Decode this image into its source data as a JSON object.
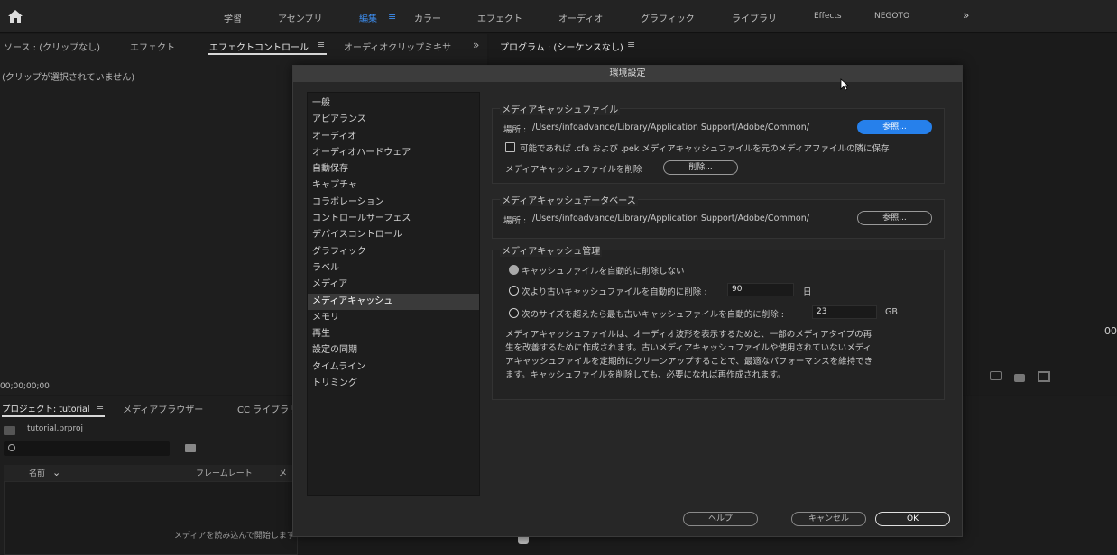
{
  "topbar": {
    "workspaces": [
      "学習",
      "アセンブリ",
      "編集",
      "カラー",
      "エフェクト",
      "オーディオ",
      "グラフィック",
      "ライブラリ",
      "Effects",
      "NEGOTO"
    ],
    "menu_glyph": "≡",
    "more_glyph": "»"
  },
  "left_panel": {
    "tabs": [
      "ソース : (クリップなし)",
      "エフェクト",
      "エフェクトコントロール",
      "オーディオクリップミキサ"
    ],
    "tab_menu_glyph": "≡",
    "more_glyph": "»",
    "empty_message": "(クリップが選択されていません)",
    "timecode": "00;00;00;00"
  },
  "program_panel": {
    "title": "プログラム : (シーケンスなし)",
    "menu_glyph": "≡",
    "timecode_fragment": "00"
  },
  "project_panel": {
    "tabs": [
      "プロジェクト: tutorial",
      "メディアブラウザー",
      "CC ライブラリ"
    ],
    "menu_glyph": "≡",
    "project_file": "tutorial.prproj",
    "columns": [
      "名前",
      "フレームレート",
      "メ"
    ],
    "empty_message": "メディアを読み込んで開始します"
  },
  "dialog": {
    "title": "環境設定",
    "categories": [
      "一般",
      "アピアランス",
      "オーディオ",
      "オーディオハードウェア",
      "自動保存",
      "キャプチャ",
      "コラボレーション",
      "コントロールサーフェス",
      "デバイスコントロール",
      "グラフィック",
      "ラベル",
      "メディア",
      "メディアキャッシュ",
      "メモリ",
      "再生",
      "設定の同期",
      "タイムライン",
      "トリミング"
    ],
    "selected_category": "メディアキャッシュ",
    "cache_files": {
      "title": "メディアキャッシュファイル",
      "location_label": "場所 :",
      "location_path": "/Users/infoadvance/Library/Application Support/Adobe/Common/",
      "browse_label": "参照...",
      "checkbox_label": "可能であれば .cfa および .pek メディアキャッシュファイルを元のメディアファイルの隣に保存",
      "delete_label": "メディアキャッシュファイルを削除",
      "delete_button": "削除..."
    },
    "cache_db": {
      "title": "メディアキャッシュデータベース",
      "location_label": "場所 :",
      "location_path": "/Users/infoadvance/Library/Application Support/Adobe/Common/",
      "browse_label": "参照..."
    },
    "cache_mgmt": {
      "title": "メディアキャッシュ管理",
      "option1": "キャッシュファイルを自動的に削除しない",
      "option2": "次より古いキャッシュファイルを自動的に削除 :",
      "option2_value": "90",
      "option2_unit": "日",
      "option3": "次のサイズを超えたら最も古いキャッシュファイルを自動的に削除 :",
      "option3_value": "23",
      "option3_unit": "GB",
      "description": "メディアキャッシュファイルは、オーディオ波形を表示するためと、一部のメディアタイプの再生を改善するために作成されます。古いメディアキャッシュファイルや使用されていないメディアキャッシュファイルを定期的にクリーンアップすることで、最適なパフォーマンスを維持できます。キャッシュファイルを削除しても、必要になれば再作成されます。"
    },
    "help_button": "ヘルプ",
    "cancel_button": "キャンセル",
    "ok_button": "OK"
  },
  "colors": {
    "accent_blue": "#2680eb",
    "active_workspace": "#3d8ef0"
  }
}
